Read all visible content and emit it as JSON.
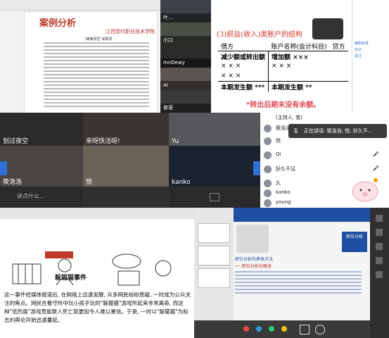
{
  "doc_case": {
    "title": "案例分析",
    "school_logo": "江西现代职业技术学院",
    "subtitle": "\"蜂拥而至\"采购员"
  },
  "video_tiles_top": [
    {
      "name": "叶…"
    },
    {
      "name": "小口"
    },
    {
      "name": "mnDewy"
    },
    {
      "name": "AI"
    },
    {
      "name": "夜语"
    }
  ],
  "slide_accounts": {
    "heading": "(3)损益(收入)类账户的结构",
    "col_left": "借方",
    "col_mid": "账户名称(会计科目)",
    "col_right": "贷方",
    "row1_left": "减少额或转出额",
    "row1_right": "增加额 ×××",
    "x_marks": "× × ×",
    "period_left": "本期发生额 ***",
    "period_right": "本期发生额 **",
    "note": "*转出后期末没有余额。"
  },
  "right_panel_top": {
    "items": [
      "编辑目录",
      "标记",
      "批注"
    ]
  },
  "video_grid": [
    {
      "name": "划过夜空"
    },
    {
      "name": "来呀快活呀!"
    },
    {
      "name": "Yu"
    },
    {
      "name": "筱浩浩"
    },
    {
      "name": "悦"
    },
    {
      "name": "kanko"
    },
    {
      "name": "说点什么…"
    }
  ],
  "speaking_banner": "正在讲话: 筱浩浩; 悦; 好久不…",
  "participants": [
    {
      "name": "(主持人, 我)"
    },
    {
      "name": "筱浩浩"
    },
    {
      "name": "悦"
    },
    {
      "name": "Qi"
    },
    {
      "name": "好久不见"
    },
    {
      "name": "久"
    },
    {
      "name": "kanko"
    },
    {
      "name": "young"
    },
    {
      "name": "YQ"
    }
  ],
  "doc_event": {
    "title": "躲猫猫事件",
    "body": "这一事件经媒体报道后, 在网络上迅速发酵, 众多网民纷纷质疑, 一时成为公众关注的焦点。网民在看守所中玩小孩子玩的\"躲猫猫\"游戏所起来非常离奇, 而这种\"低烈度\"游戏竟能致人死亡就更加令人难以置信。于是, 一时以\"躲猫猫\"为标志的舆论开始迅速蔓延。"
  },
  "slide_job": {
    "header": "职位分析的具体方法",
    "sub": "一. 职位分析的概述",
    "badge": "职位分析"
  },
  "colors": {
    "accent_red": "#d4372b",
    "meeting_dark": "#1e1e1e"
  }
}
